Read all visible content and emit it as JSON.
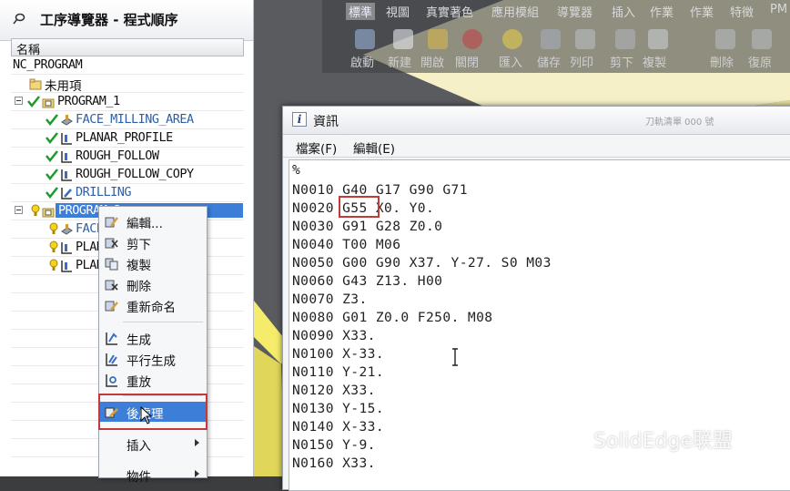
{
  "navigator": {
    "title": "工序導覽器 - 程式順序",
    "column_header": "名稱",
    "rows": [
      {
        "label": "NC_PROGRAM"
      },
      {
        "label": "未用項"
      },
      {
        "label": "PROGRAM_1"
      },
      {
        "label": "FACE_MILLING_AREA"
      },
      {
        "label": "PLANAR_PROFILE"
      },
      {
        "label": "ROUGH_FOLLOW"
      },
      {
        "label": "ROUGH_FOLLOW_COPY"
      },
      {
        "label": "DRILLING"
      },
      {
        "label": "PROGRAM_2"
      },
      {
        "label": "FACE_MILLING_AREA_1"
      },
      {
        "label": "PLANAR_PROFILE_1"
      },
      {
        "label": "PLANAR_PROFILE_2"
      }
    ]
  },
  "toolbar": {
    "tabs": [
      "標準",
      "視圖",
      "真實著色",
      "應用模組",
      "導覽器",
      "插入",
      "作業",
      "作業",
      "特徵",
      "PM"
    ],
    "buttons": [
      "啟動",
      "新建",
      "開啟",
      "關閉",
      "匯入",
      "儲存",
      "列印",
      "剪下",
      "複製",
      "刪除",
      "復原"
    ]
  },
  "info_dialog": {
    "title": "資訊",
    "faded_title": "刀軌清單 000 號",
    "menu": [
      "檔案(F)",
      "編輯(E)"
    ],
    "lines": [
      "%",
      "N0010 G40 G17 G90 G71",
      "N0020 G55 X0. Y0.",
      "N0030 G91 G28 Z0.0",
      "N0040 T00 M06",
      "N0050 G00 G90 X37. Y-27. S0 M03",
      "N0060 G43 Z13. H00",
      "N0070 Z3.",
      "N0080 G01 Z0.0 F250. M08",
      "N0090 X33.",
      "N0100 X-33.",
      "N0110 Y-21.",
      "N0120 X33.",
      "N0130 Y-15.",
      "N0140 X-33.",
      "N0150 Y-9.",
      "N0160 X33."
    ]
  },
  "context_menu": {
    "items": [
      "編輯...",
      "剪下",
      "複製",
      "刪除",
      "重新命名",
      "生成",
      "平行生成",
      "重放",
      "後處理",
      "插入",
      "物件"
    ]
  },
  "watermark": "SolidEdge联盟",
  "colors": {
    "selection": "#3d7ed8",
    "highlight_box": "#c23a3a",
    "check": "#1f9a2e",
    "link_text": "#2e5fa8"
  }
}
